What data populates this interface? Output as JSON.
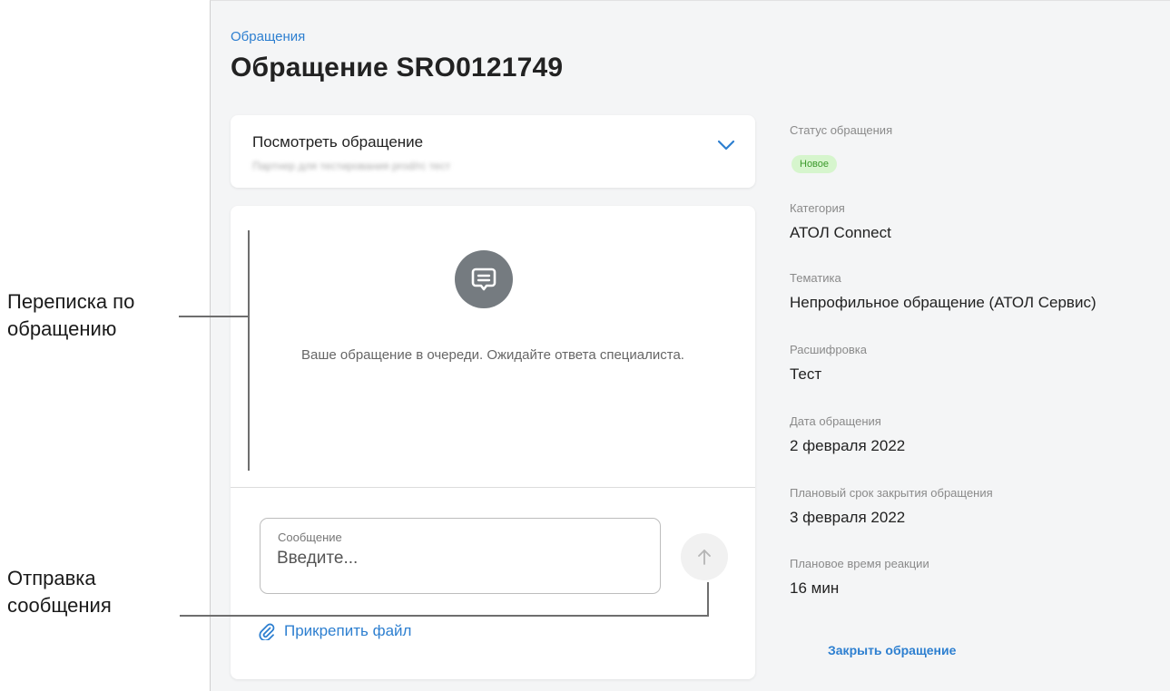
{
  "breadcrumb": "Обращения",
  "page_title": "Обращение SRO0121749",
  "view_request": {
    "title": "Посмотреть обращение",
    "subtitle": "Партнер для тестирования prod/rc тест",
    "chevron_icon": "chevron-down-icon"
  },
  "chat": {
    "icon": "chat-bubble-icon",
    "queue_message": "Ваше обращение в очереди. Ожидайте ответа специалиста.",
    "message_label": "Сообщение",
    "message_placeholder": "Введите...",
    "send_icon": "arrow-up-icon",
    "attach_label": "Прикрепить файл",
    "attach_icon": "paperclip-icon"
  },
  "details": {
    "status_label": "Статус обращения",
    "status_value": "Новое",
    "category_label": "Категория",
    "category_value": "АТОЛ Connect",
    "topic_label": "Тематика",
    "topic_value": "Непрофильное обращение (АТОЛ Сервис)",
    "decoding_label": "Расшифровка",
    "decoding_value": "Тест",
    "date_label": "Дата обращения",
    "date_value": "2 февраля 2022",
    "planned_close_label": "Плановый срок закрытия обращения",
    "planned_close_value": "3 февраля 2022",
    "reaction_label": "Плановое время реакции",
    "reaction_value": "16 мин",
    "close_button": "Закрыть обращение"
  },
  "annotations": {
    "correspondence_line1": "Переписка по",
    "correspondence_line2": "обращению",
    "sending_line1": "Отправка",
    "sending_line2": "сообщения"
  },
  "colors": {
    "accent": "#2d7fd0",
    "badge_bg": "#d6f5cd",
    "badge_text": "#3c9a2c",
    "icon_gray": "#757b80"
  }
}
